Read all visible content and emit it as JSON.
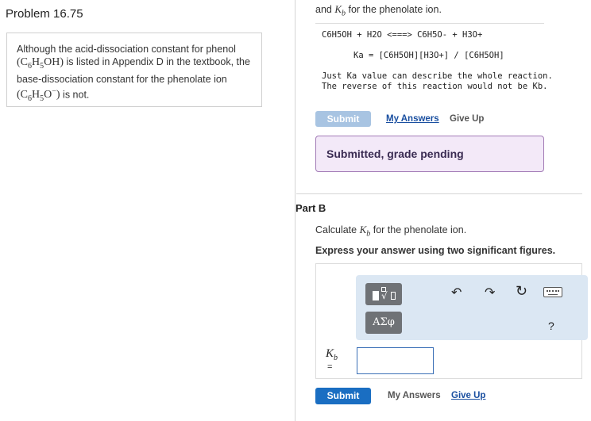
{
  "problem": {
    "title": "Problem 16.75",
    "text_intro": "Although the acid-dissociation constant for phenol",
    "phenol_formula": "(C6H5OH)",
    "text_mid": "is listed in Appendix D in the textbook, the base-dissociation constant for the phenolate ion",
    "phenolate_formula": "(C6H5O−)",
    "text_end": "is not."
  },
  "part_a": {
    "top_line": "and Kb for the phenolate ion.",
    "code_line1": "C6H5OH + H2O <===> C6H5O- + H3O+",
    "code_line2": "Ka = [C6H5OH][H3O+] / [C6H5OH]",
    "code_para": "Just Ka value can describe the whole reaction. The reverse of this reaction would not be Kb.",
    "submit_label": "Submit",
    "my_answers_label": "My Answers",
    "give_up_label": "Give Up",
    "grade_status": "Submitted, grade pending"
  },
  "part_b": {
    "title": "Part B",
    "prompt": "Calculate Kb for the phenolate ion.",
    "instruction": "Express your answer using two significant figures.",
    "greek_label": "ΑΣφ",
    "help_label": "?",
    "variable_label": "K",
    "variable_sub": "b",
    "equals": "=",
    "answer_value": "",
    "submit_label": "Submit",
    "my_answers_label": "My Answers",
    "give_up_label": "Give Up"
  },
  "icons": {
    "templates": "templates-icon",
    "greek": "greek-symbols-icon",
    "undo": "undo-icon",
    "redo": "redo-icon",
    "reset": "reset-icon",
    "keyboard": "keyboard-icon",
    "help": "help-icon"
  },
  "colors": {
    "submit_blue": "#1a6ec2",
    "submit_disabled": "#a8c4e2",
    "grade_bg": "#f3e9f8",
    "grade_border": "#a27bb6",
    "toolbar_bg": "#dbe7f3"
  }
}
